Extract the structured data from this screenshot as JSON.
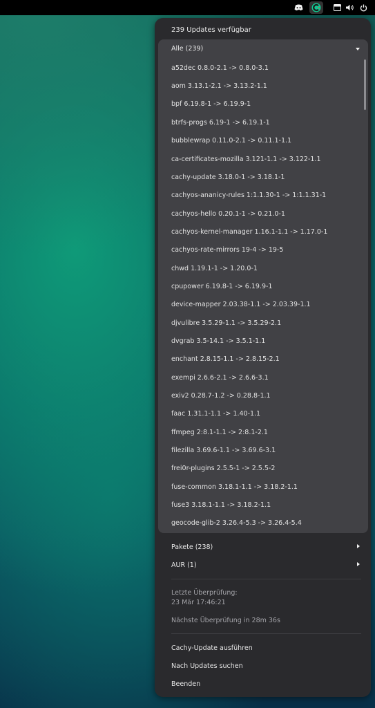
{
  "topbar": {
    "icons": [
      "discord-icon",
      "cachy-update-icon",
      "window-icon",
      "volume-icon",
      "power-icon"
    ]
  },
  "menu": {
    "title": "239 Updates verfügbar",
    "all_section": {
      "label": "Alle (239)",
      "items": [
        "a52dec 0.8.0-2.1 -> 0.8.0-3.1",
        "aom 3.13.1-2.1 -> 3.13.2-1.1",
        "bpf 6.19.8-1 -> 6.19.9-1",
        "btrfs-progs 6.19-1 -> 6.19.1-1",
        "bubblewrap 0.11.0-2.1 -> 0.11.1-1.1",
        "ca-certificates-mozilla 3.121-1.1 -> 3.122-1.1",
        "cachy-update 3.18.0-1 -> 3.18.1-1",
        "cachyos-ananicy-rules 1:1.1.30-1 -> 1:1.1.31-1",
        "cachyos-hello 0.20.1-1 -> 0.21.0-1",
        "cachyos-kernel-manager 1.16.1-1.1 -> 1.17.0-1",
        "cachyos-rate-mirrors 19-4 -> 19-5",
        "chwd 1.19.1-1 -> 1.20.0-1",
        "cpupower 6.19.8-1 -> 6.19.9-1",
        "device-mapper 2.03.38-1.1 -> 2.03.39-1.1",
        "djvulibre 3.5.29-1.1 -> 3.5.29-2.1",
        "dvgrab 3.5-14.1 -> 3.5.1-1.1",
        "enchant 2.8.15-1.1 -> 2.8.15-2.1",
        "exempi 2.6.6-2.1 -> 2.6.6-3.1",
        "exiv2 0.28.7-1.2 -> 0.28.8-1.1",
        "faac 1.31.1-1.1 -> 1.40-1.1",
        "ffmpeg 2:8.1-1.1 -> 2:8.1-2.1",
        "filezilla 3.69.6-1.1 -> 3.69.6-3.1",
        "frei0r-plugins 2.5.5-1 -> 2.5.5-2",
        "fuse-common 3.18.1-1.1 -> 3.18.2-1.1",
        "fuse3 3.18.1-1.1 -> 3.18.2-1.1",
        "geocode-glib-2 3.26.4-5.3 -> 3.26.4-5.4"
      ]
    },
    "packages_label": "Pakete (238)",
    "aur_label": "AUR (1)",
    "last_check_label": "Letzte Überprüfung:",
    "last_check_time": "23 Mär 17:46:21",
    "next_check": "Nächste Überprüfung in 28m 36s",
    "actions": {
      "run": "Cachy-Update ausführen",
      "search": "Nach Updates suchen",
      "quit": "Beenden"
    }
  }
}
